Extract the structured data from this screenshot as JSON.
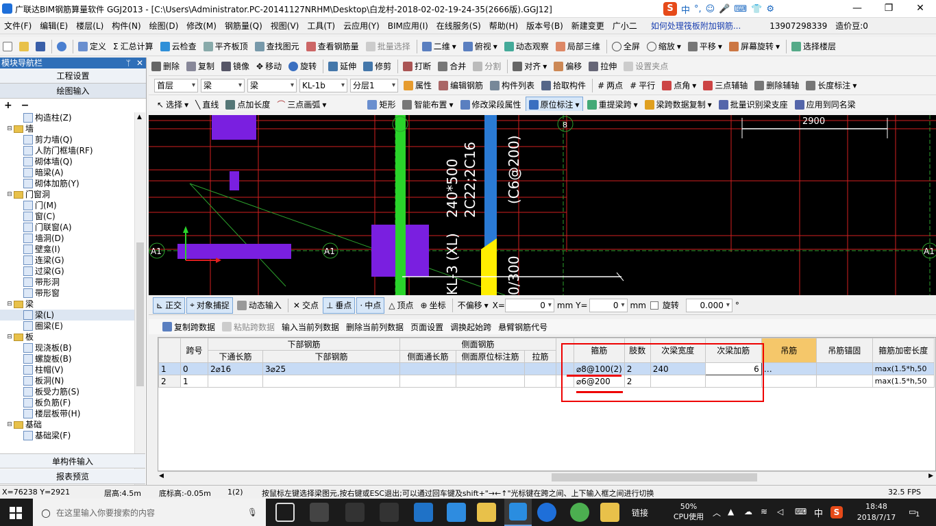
{
  "window": {
    "title": "广联达BIM钢筋算量软件 GGJ2013 - [C:\\Users\\Administrator.PC-20141127NRHM\\Desktop\\白龙村-2018-02-02-19-24-35(2666版).GGJ12]",
    "minimize": "—",
    "maximize": "❐",
    "close": "✕",
    "ime": [
      "中",
      "°,",
      "☺",
      "🎤",
      "⌨",
      "👕",
      "⚙"
    ]
  },
  "menu": [
    "文件(F)",
    "编辑(E)",
    "楼层(L)",
    "构件(N)",
    "绘图(D)",
    "修改(M)",
    "钢筋量(Q)",
    "视图(V)",
    "工具(T)",
    "云应用(Y)",
    "BIM应用(I)",
    "在线服务(S)",
    "帮助(H)",
    "版本号(B)",
    "新建变更",
    "广小二",
    "如何处理筏板附加钢筋...",
    "13907298339",
    "造价豆:0"
  ],
  "toolbar1": [
    "定义",
    "汇总计算",
    "云检查",
    "平齐板顶",
    "查找图元",
    "查看钢筋量",
    "批量选择",
    "二维",
    "俯视",
    "动态观察",
    "局部三维",
    "全屏",
    "缩放",
    "平移",
    "屏幕旋转",
    "选择楼层"
  ],
  "toolbar2": [
    "删除",
    "复制",
    "镜像",
    "移动",
    "旋转",
    "延伸",
    "修剪",
    "打断",
    "合并",
    "分割",
    "对齐",
    "偏移",
    "拉伸",
    "设置夹点"
  ],
  "toolbar3": {
    "floor": "首层",
    "cat1": "梁",
    "cat2": "梁",
    "member": "KL-1b",
    "layer": "分层1",
    "buttons": [
      "属性",
      "编辑钢筋",
      "构件列表",
      "拾取构件",
      "两点",
      "平行",
      "点角",
      "三点辅轴",
      "删除辅轴",
      "长度标注"
    ]
  },
  "toolbar4": [
    "选择",
    "直线",
    "点加长度",
    "三点画弧",
    "矩形",
    "智能布置",
    "修改梁段属性",
    "原位标注",
    "重提梁跨",
    "梁跨数据复制",
    "批量识别梁支座",
    "应用到同名梁"
  ],
  "left": {
    "title": "模块导航栏",
    "pin": "ᛘ",
    "close": "✕",
    "btn1": "工程设置",
    "btn2": "绘图输入",
    "expand": "+",
    "collapse": "−",
    "bottom1": "单构件输入",
    "bottom2": "报表预览",
    "tree": [
      {
        "t": "构造柱(Z)",
        "lvl": 2
      },
      {
        "t": "墙",
        "lvl": 1,
        "folder": true
      },
      {
        "t": "剪力墙(Q)",
        "lvl": 2
      },
      {
        "t": "人防门框墙(RF)",
        "lvl": 2
      },
      {
        "t": "砌体墙(Q)",
        "lvl": 2
      },
      {
        "t": "暗梁(A)",
        "lvl": 2
      },
      {
        "t": "砌体加筋(Y)",
        "lvl": 2
      },
      {
        "t": "门窗洞",
        "lvl": 1,
        "folder": true
      },
      {
        "t": "门(M)",
        "lvl": 2
      },
      {
        "t": "窗(C)",
        "lvl": 2
      },
      {
        "t": "门联窗(A)",
        "lvl": 2
      },
      {
        "t": "墙洞(D)",
        "lvl": 2
      },
      {
        "t": "壁龛(I)",
        "lvl": 2
      },
      {
        "t": "连梁(G)",
        "lvl": 2
      },
      {
        "t": "过梁(G)",
        "lvl": 2
      },
      {
        "t": "带形洞",
        "lvl": 2
      },
      {
        "t": "带形窗",
        "lvl": 2
      },
      {
        "t": "梁",
        "lvl": 1,
        "folder": true
      },
      {
        "t": "梁(L)",
        "lvl": 2,
        "sel": true
      },
      {
        "t": "圈梁(E)",
        "lvl": 2
      },
      {
        "t": "板",
        "lvl": 1,
        "folder": true
      },
      {
        "t": "现浇板(B)",
        "lvl": 2
      },
      {
        "t": "螺旋板(B)",
        "lvl": 2
      },
      {
        "t": "柱帽(V)",
        "lvl": 2
      },
      {
        "t": "板洞(N)",
        "lvl": 2
      },
      {
        "t": "板受力筋(S)",
        "lvl": 2
      },
      {
        "t": "板负筋(F)",
        "lvl": 2
      },
      {
        "t": "楼层板带(H)",
        "lvl": 2
      },
      {
        "t": "基础",
        "lvl": 1,
        "folder": true
      },
      {
        "t": "基础梁(F)",
        "lvl": 2
      }
    ]
  },
  "cad": {
    "dim": "2900",
    "axis_a1": "A1",
    "axis_8": "8",
    "labels": [
      "240*500",
      "2C22;2C16",
      "(C6@200)",
      "KL-3 (XL)",
      "0/300"
    ]
  },
  "snap": {
    "buttons": [
      "正交",
      "对象捕捉",
      "动态输入",
      "交点",
      "垂点",
      "中点",
      "顶点",
      "坐标"
    ],
    "offset": "不偏移",
    "x_label": "X=",
    "x": "0",
    "y_label": "mm Y=",
    "y": "0",
    "unit": "mm",
    "rotate": "旋转",
    "angle": "0.000",
    "deg": "°"
  },
  "gridtool": [
    "复制跨数据",
    "粘贴跨数据",
    "输入当前列数据",
    "删除当前列数据",
    "页面设置",
    "调换起始跨",
    "悬臂钢筋代号"
  ],
  "table": {
    "group_lower": "下部钢筋",
    "group_side": "侧面钢筋",
    "headers": [
      "跨号",
      "下通长筋",
      "下部钢筋",
      "侧面通长筋",
      "侧面原位标注筋",
      "拉筋",
      "",
      "箍筋",
      "肢数",
      "次梁宽度",
      "次梁加筋",
      "吊筋",
      "吊筋锚固",
      "箍筋加密长度"
    ],
    "rows": [
      [
        "1",
        "0",
        "2⌀16",
        "3⌀25",
        "",
        "",
        "",
        "",
        "⌀8@100(2)",
        "2",
        "240",
        "6",
        "…",
        "",
        "max(1.5*h,50"
      ],
      [
        "2",
        "1",
        "",
        "",
        "",
        "",
        "",
        "",
        "⌀6@200",
        "2",
        "",
        "",
        "",
        "",
        "max(1.5*h,50"
      ]
    ]
  },
  "status": {
    "coords": "X=76238 Y=2921",
    "floorh": "层高:4.5m",
    "bottomh": "底标高:-0.05m",
    "span": "1(2)",
    "hint": "按鼠标左键选择梁图元,按右键或ESC退出;可以通过回车键及shift+\"→←↑\"光标键在跨之间、上下输入框之间进行切换",
    "fps": "32.5 FPS"
  },
  "taskbar": {
    "search": "在这里输入你要搜索的内容",
    "link": "链接",
    "cpu": "50%",
    "cpu_label": "CPU使用",
    "lang": "中",
    "time": "18:48",
    "date": "2018/7/17",
    "badge": "1"
  }
}
